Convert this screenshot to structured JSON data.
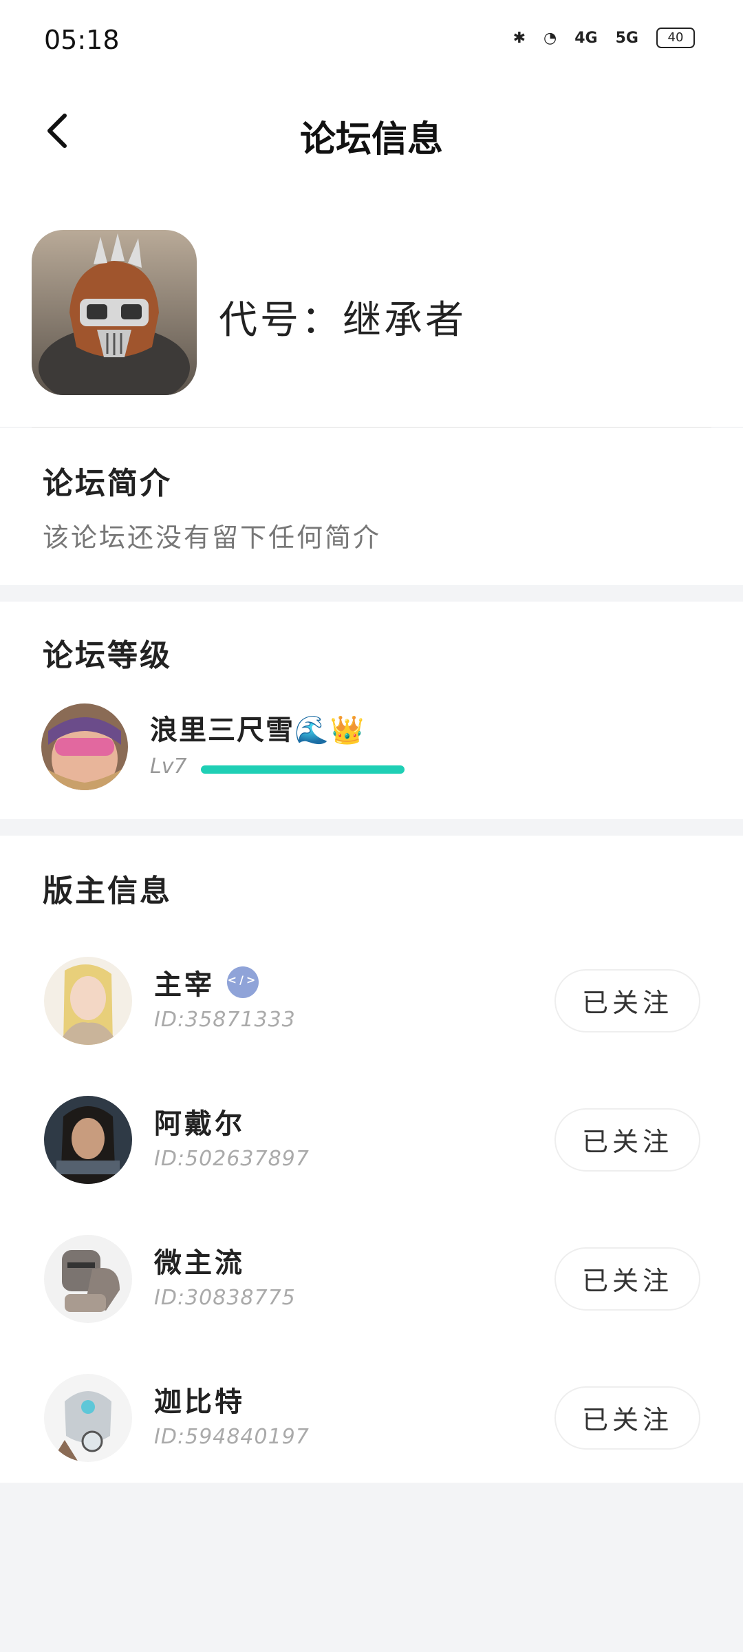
{
  "status_bar": {
    "time": "05:18",
    "icons": [
      "bluetooth-icon",
      "battery-saver-icon",
      "hd-icon",
      "signal-4g-icon",
      "signal-5g-icon",
      "battery-icon"
    ],
    "net1": "4G",
    "net2": "5G",
    "battery_level": "40"
  },
  "header": {
    "title": "论坛信息",
    "back_icon": "chevron-left-icon"
  },
  "forum": {
    "code_label": "代号：",
    "code_value": "继承者"
  },
  "intro": {
    "title": "论坛简介",
    "text": "该论坛还没有留下任何简介"
  },
  "level": {
    "title": "论坛等级",
    "user_name": "浪里三尺雪🌊👑",
    "level_label": "Lv7",
    "progress": 1.0
  },
  "moderators": {
    "title": "版主信息",
    "items": [
      {
        "name": "主宰",
        "id": "ID:35871333",
        "button": "已关注",
        "has_badge": true
      },
      {
        "name": "阿戴尔",
        "id": "ID:502637897",
        "button": "已关注",
        "has_badge": false
      },
      {
        "name": "微主流",
        "id": "ID:30838775",
        "button": "已关注",
        "has_badge": false
      },
      {
        "name": "迦比特",
        "id": "ID:594840197",
        "button": "已关注",
        "has_badge": false
      }
    ]
  },
  "colors": {
    "accent": "#1fcfb5",
    "background": "#f3f4f6"
  }
}
